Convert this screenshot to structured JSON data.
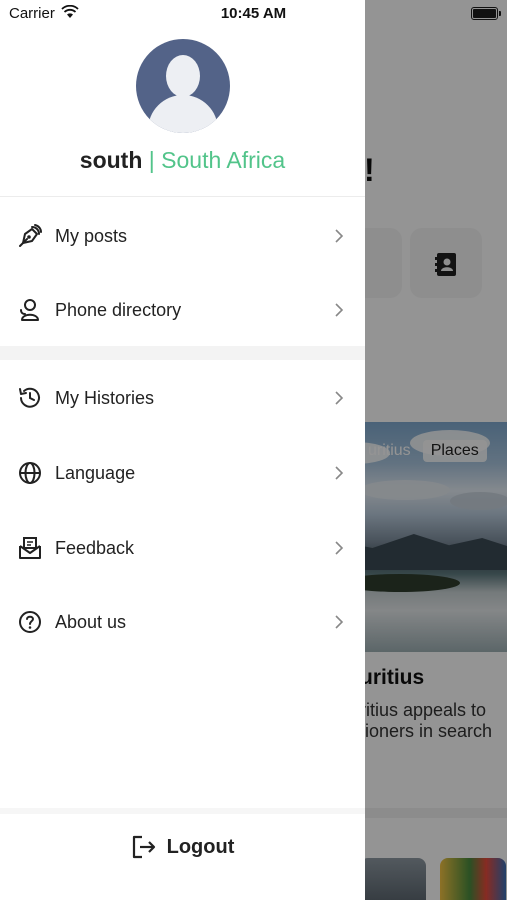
{
  "status_bar": {
    "carrier": "Carrier",
    "time": "10:45 AM"
  },
  "profile": {
    "name": "south",
    "separator": "|",
    "country": "South Africa",
    "accent_color": "#52c48a"
  },
  "menu": {
    "items": [
      {
        "label": "My posts",
        "icon": "pen-nib-icon"
      },
      {
        "label": "Phone directory",
        "icon": "contact-person-icon"
      },
      {
        "label": "My Histories",
        "icon": "history-clock-icon"
      },
      {
        "label": "Language",
        "icon": "globe-icon"
      },
      {
        "label": "Feedback",
        "icon": "mail-feedback-icon"
      },
      {
        "label": "About us",
        "icon": "question-circle-icon"
      }
    ]
  },
  "logout": {
    "label": "Logout",
    "icon": "logout-icon"
  },
  "background": {
    "exclaim": "!",
    "tags": [
      "uritius",
      "Places"
    ],
    "place_title": "uritius",
    "description_lines": [
      "ritius appeals to",
      "tioners in search"
    ]
  }
}
